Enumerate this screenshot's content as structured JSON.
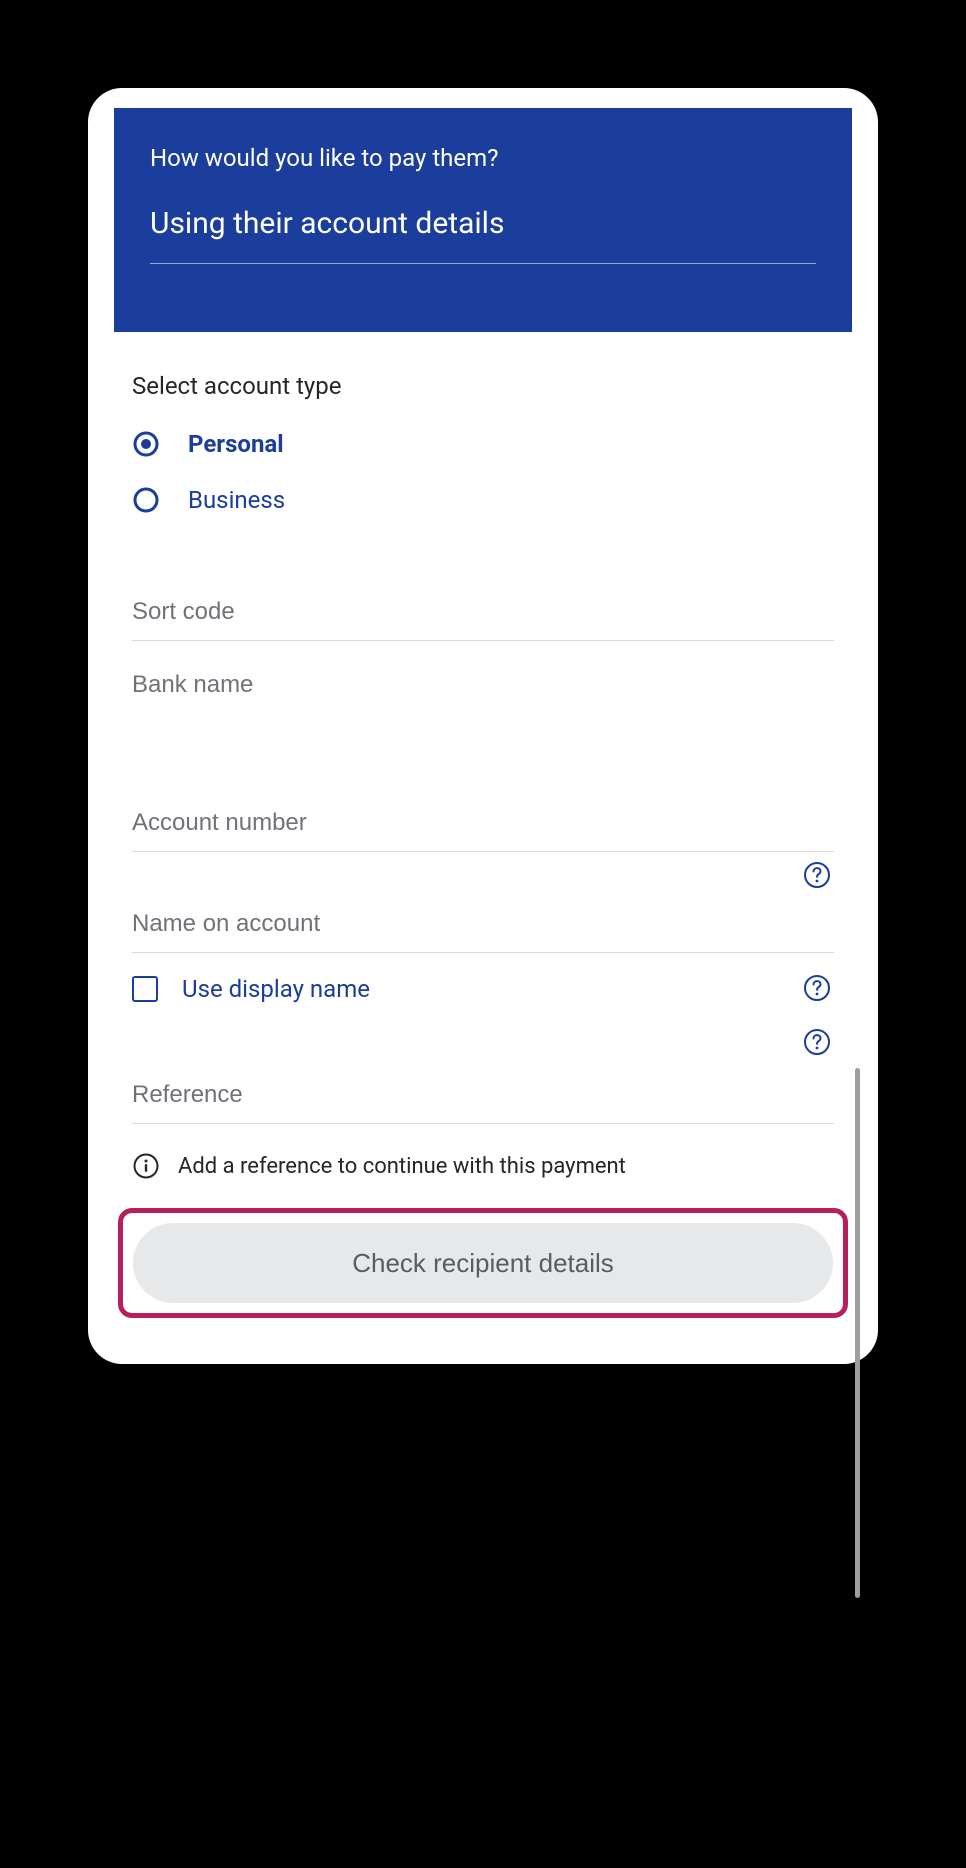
{
  "header": {
    "question": "How would you like to pay them?",
    "method": "Using their account details"
  },
  "accountType": {
    "sectionLabel": "Select account type",
    "options": {
      "personal": {
        "label": "Personal",
        "selected": true
      },
      "business": {
        "label": "Business",
        "selected": false
      }
    }
  },
  "fields": {
    "sortCode": {
      "placeholder": "Sort code",
      "value": ""
    },
    "bankName": {
      "placeholder": "Bank name",
      "value": ""
    },
    "accountNumber": {
      "placeholder": "Account number",
      "value": ""
    },
    "nameOnAccount": {
      "placeholder": "Name on account",
      "value": ""
    },
    "reference": {
      "placeholder": "Reference",
      "value": ""
    }
  },
  "useDisplayName": {
    "label": "Use display name",
    "checked": false
  },
  "infoMessage": "Add a reference to continue with this payment",
  "cta": {
    "label": "Check recipient details"
  },
  "colors": {
    "brand": "#1b3d9b",
    "highlight": "#b81e5b",
    "placeholder": "#6f7278",
    "buttonBg": "#e7e8e9",
    "buttonText": "#5a5c60"
  }
}
